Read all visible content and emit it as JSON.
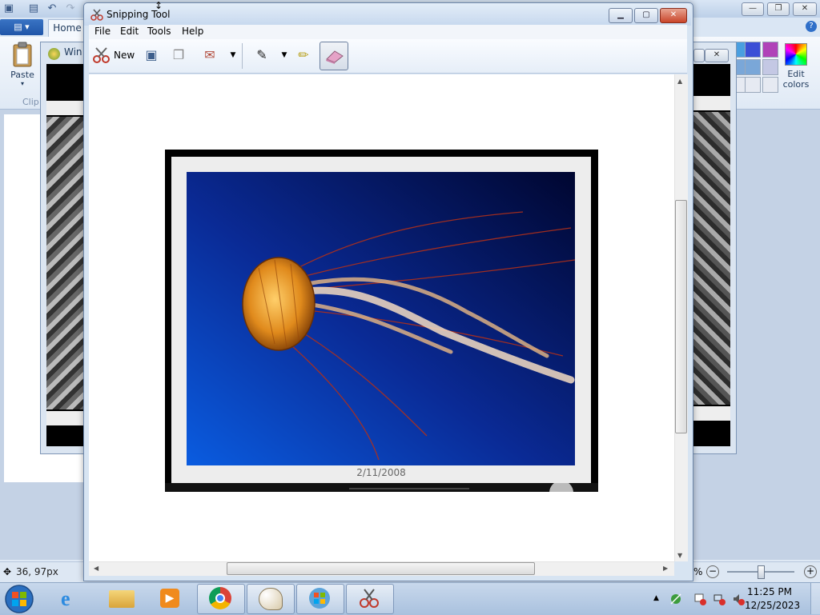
{
  "paint": {
    "home_tab": "Home",
    "paste_label": "Paste",
    "clipboard_label": "Clip",
    "edit_colors_label": "Edit colors",
    "coords": "36, 97px",
    "zoom_text": "%"
  },
  "viewer": {
    "title": "Win"
  },
  "snipping_tool": {
    "title": "Snipping Tool",
    "menu": [
      "File",
      "Edit",
      "Tools",
      "Help"
    ],
    "new_label": "New",
    "photo_date": "2/11/2008"
  },
  "taskbar": {
    "time": "11:25 PM",
    "date": "12/25/2023"
  },
  "colors": {
    "swatches": [
      "#4a9fe0",
      "#3b4fd6",
      "#b043b8",
      "#7aa7d8",
      "#c4c8e4",
      "#d8e4f0",
      "#e6eaf2"
    ]
  }
}
